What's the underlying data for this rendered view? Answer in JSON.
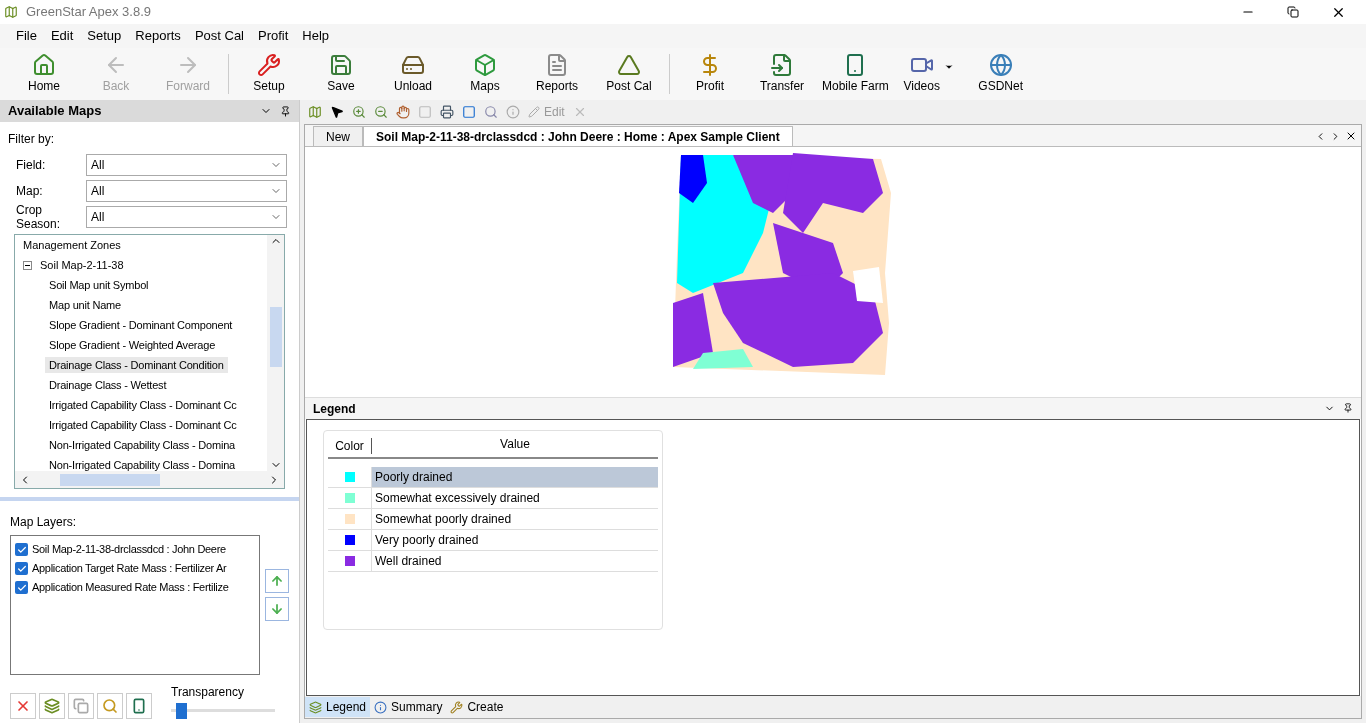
{
  "window": {
    "title": "GreenStar Apex 3.8.9"
  },
  "menu": [
    "File",
    "Edit",
    "Setup",
    "Reports",
    "Post Cal",
    "Profit",
    "Help"
  ],
  "toolbar": [
    {
      "label": "Home",
      "disabled": false,
      "has_menu": false
    },
    {
      "label": "Back",
      "disabled": true,
      "has_menu": false
    },
    {
      "label": "Forward",
      "disabled": true,
      "has_menu": false
    },
    {
      "label": "Setup",
      "disabled": false,
      "has_menu": false
    },
    {
      "label": "Save",
      "disabled": false,
      "has_menu": false
    },
    {
      "label": "Unload",
      "disabled": false,
      "has_menu": false
    },
    {
      "label": "Maps",
      "disabled": false,
      "has_menu": false
    },
    {
      "label": "Reports",
      "disabled": false,
      "has_menu": false
    },
    {
      "label": "Post Cal",
      "disabled": false,
      "has_menu": false
    },
    {
      "label": "Profit",
      "disabled": false,
      "has_menu": false
    },
    {
      "label": "Transfer",
      "disabled": false,
      "has_menu": false
    },
    {
      "label": "Mobile Farm",
      "disabled": false,
      "has_menu": false
    },
    {
      "label": "Videos",
      "disabled": false,
      "has_menu": true
    },
    {
      "label": "GSDNet",
      "disabled": false,
      "has_menu": false
    }
  ],
  "available_maps": {
    "title": "Available Maps",
    "filter_label": "Filter by:",
    "filters": [
      {
        "label": "Field:",
        "value": "All"
      },
      {
        "label": "Map:",
        "value": "All"
      },
      {
        "label": "Crop Season:",
        "value": "All"
      }
    ],
    "tree": [
      {
        "label": "Management Zones",
        "selected": false
      },
      {
        "label": "Soil Map-2-11-38",
        "expanded": true,
        "selected": false,
        "children": [
          {
            "label": "Soil Map unit Symbol",
            "selected": false
          },
          {
            "label": "Map unit Name",
            "selected": false
          },
          {
            "label": "Slope Gradient - Dominant Component",
            "selected": false
          },
          {
            "label": "Slope Gradient - Weighted Average",
            "selected": false
          },
          {
            "label": "Drainage Class - Dominant Condition",
            "selected": true
          },
          {
            "label": "Drainage Class - Wettest",
            "selected": false
          },
          {
            "label": "Irrigated Capability Class - Dominant Cc",
            "selected": false
          },
          {
            "label": "Irrigated Capability Class - Dominant Cc",
            "selected": false
          },
          {
            "label": "Non-Irrigated Capability Class - Domina",
            "selected": false
          },
          {
            "label": "Non-Irrigated Capability Class - Domina",
            "selected": false
          }
        ]
      }
    ]
  },
  "map_layers": {
    "label": "Map Layers:",
    "layers": [
      {
        "label": "Soil Map-2-11-38-drclassdcd : John Deere",
        "checked": true
      },
      {
        "label": "Application Target Rate Mass : Fertilizer Ar",
        "checked": true
      },
      {
        "label": "Application Measured Rate Mass : Fertilize",
        "checked": true
      }
    ]
  },
  "transparency": {
    "label": "Transparency",
    "level": 0.05
  },
  "map_toolbar": {
    "edit_label": "Edit"
  },
  "document_tabs": [
    {
      "label": "New",
      "selected": false
    },
    {
      "label": "Soil Map-2-11-38-drclassdcd : John Deere : Home : Apex Sample Client",
      "selected": true
    }
  ],
  "legend": {
    "title": "Legend",
    "columns": [
      "Color",
      "Value"
    ],
    "rows": [
      {
        "color": "#00ffff",
        "value": "Poorly drained",
        "selected": true
      },
      {
        "color": "#7fffd4",
        "value": "Somewhat excessively drained",
        "selected": false
      },
      {
        "color": "#ffe4c4",
        "value": "Somewhat poorly drained",
        "selected": false
      },
      {
        "color": "#0000ff",
        "value": "Very poorly drained",
        "selected": false
      },
      {
        "color": "#8a2be2",
        "value": "Well drained",
        "selected": false
      }
    ]
  },
  "bottom_tabs": [
    {
      "label": "Legend",
      "selected": true
    },
    {
      "label": "Summary",
      "selected": false
    },
    {
      "label": "Create",
      "selected": false
    }
  ]
}
